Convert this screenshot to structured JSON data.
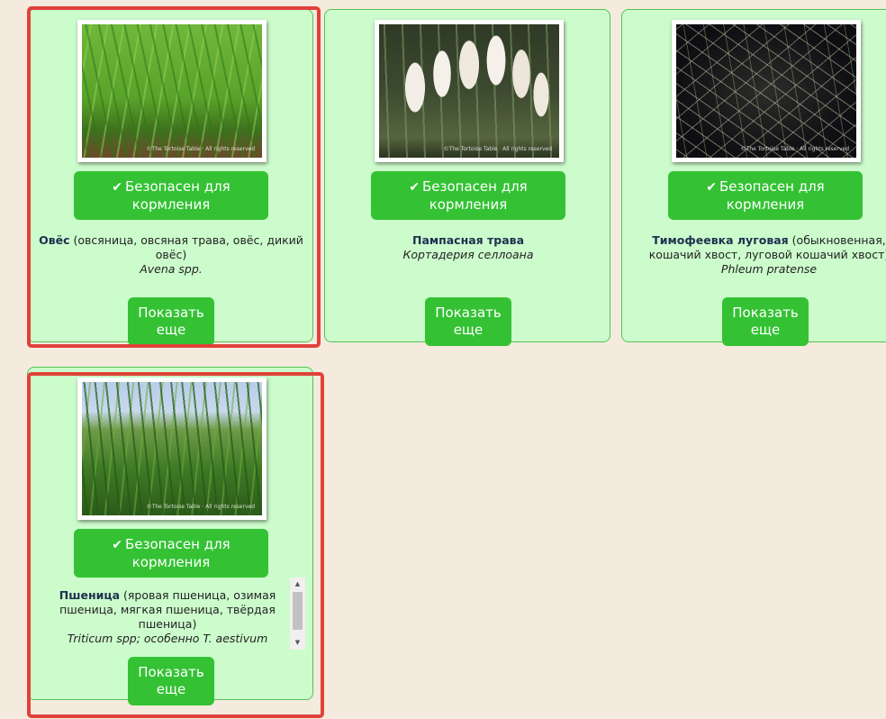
{
  "cards": [
    {
      "safe_label_line1": "Безопасен для",
      "safe_label_line2": "кормления",
      "name": "Овёс",
      "alt_names": " (овсяница, овсяная трава, овёс, дикий овёс)",
      "latin": "Avena spp.",
      "more_line1": "Показать",
      "more_line2": "еще"
    },
    {
      "safe_label_line1": "Безопасен для",
      "safe_label_line2": "кормления",
      "name": "Пампасная трава",
      "alt_names": "",
      "latin": "Кортадерия селлоана",
      "more_line1": "Показать",
      "more_line2": "еще"
    },
    {
      "safe_label_line1": "Безопасен для",
      "safe_label_line2": "кормления",
      "name": "Тимофеевка луговая",
      "alt_names": " (обыкновенная, кошачий хвост, луговой кошачий хвост)",
      "latin": "Phleum pratense",
      "more_line1": "Показать",
      "more_line2": "еще"
    },
    {
      "safe_label_line1": "Безопасен для",
      "safe_label_line2": "кормления",
      "name": "Пшеница",
      "alt_names": " (яровая пшеница, озимая пшеница, мягкая пшеница, твёрдая пшеница)",
      "latin": "Triticum spp; особенно T. aestivum",
      "more_line1": "Показать",
      "more_line2": "еще"
    }
  ],
  "watermark": "©The Tortoise Table · All rights reserved",
  "icons": {
    "check": "check-icon",
    "scroll_up": "scroll-up-arrow-icon",
    "scroll_down": "scroll-down-arrow-icon"
  },
  "colors": {
    "page_bg": "#f4ebde",
    "card_bg": "#ccfccc",
    "button_green": "#34c234",
    "highlight_red": "#e0413a"
  }
}
